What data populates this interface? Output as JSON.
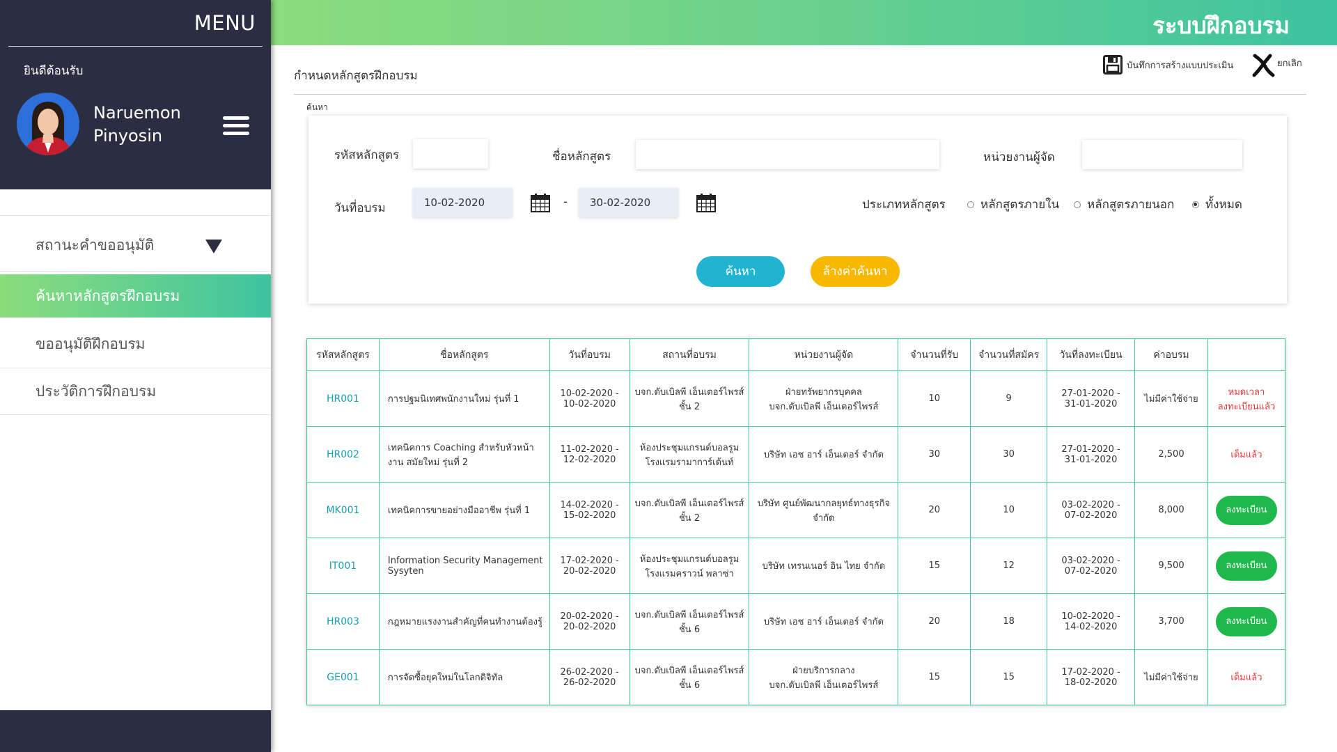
{
  "sidebar": {
    "menu_title": "MENU",
    "welcome": "ยินดีต้อนรับ",
    "user": {
      "first_name": "Naruemon",
      "last_name": "Pinyosin"
    },
    "items": [
      {
        "label": "สถานะคำขออนุมัติ"
      },
      {
        "label": "ค้นหาหลักสูตรฝึกอบรม"
      },
      {
        "label": "ขออนุมัติฝึกอบรม"
      },
      {
        "label": "ประวัติการฝึกอบรม"
      }
    ]
  },
  "header": {
    "system_title": "ระบบฝึกอบรม"
  },
  "page": {
    "title": "กำหนดหลักสูตรฝึกอบรม",
    "save_label": "บันทึกการสร้างแบบประเมิน",
    "cancel_label": "ยกเลิก",
    "search_caption": "ค้นหา"
  },
  "search": {
    "course_code_label": "รหัสหลักสูตร",
    "course_code_value": "",
    "course_name_label": "ชื่อหลักสูตร",
    "course_name_value": "",
    "organizer_label": "หน่วยงานผู้จัด",
    "organizer_value": "",
    "date_label": "วันที่อบรม",
    "date_from": "10-02-2020",
    "date_separator": "-",
    "date_to": "30-02-2020",
    "type_label": "ประเภทหลักสูตร",
    "type_options": [
      {
        "label": "หลักสูตรภายใน",
        "selected": false
      },
      {
        "label": "หลักสูตรภายนอก",
        "selected": false
      },
      {
        "label": "ทั้งหมด",
        "selected": true
      }
    ],
    "search_button": "ค้นหา",
    "clear_button": "ล้างค่าค้นหา"
  },
  "table": {
    "headers": [
      "รหัสหลักสูตร",
      "ชื่อหลักสูตร",
      "วันที่อบรม",
      "สถานที่อบรม",
      "หน่วยงานผู้จัด",
      "จำนวนที่รับ",
      "จำนวนที่สมัคร",
      "วันที่ลงทะเบียน",
      "ค่าอบรม",
      ""
    ],
    "rows": [
      {
        "code": "HR001",
        "name": "การปฐมนิเทศพนักงานใหม่ รุ่นที่ 1",
        "train_date_1": "10-02-2020 -",
        "train_date_2": "10-02-2020",
        "place_1": "บจก.ดับเบิลพี เอ็นเตอร์ไพรส์",
        "place_2": "ชั้น 2",
        "org_1": "ฝ่ายทรัพยากรบุคคล",
        "org_2": "บจก.ดับเบิลพี เอ็นเตอร์ไพรส์",
        "capacity": "10",
        "applied": "9",
        "reg_date_1": "27-01-2020 -",
        "reg_date_2": "31-01-2020",
        "fee": "ไม่มีค่าใช้จ่าย",
        "status_1": "หมดเวลา",
        "status_2": "ลงทะเบียนแล้ว",
        "status_type": "text"
      },
      {
        "code": "HR002",
        "name": "เทคนิคการ Coaching สำหรับหัวหน้างาน สมัยใหม่ รุ่นที่ 2",
        "train_date_1": "11-02-2020 -",
        "train_date_2": "12-02-2020",
        "place_1": "ห้องประชุมแกรนด์บอลรูม",
        "place_2": "โรงแรมรามาการ์เด้นท์",
        "org_1": "บริษัท เอช อาร์ เอ็นเตอร์ จำกัด",
        "org_2": "",
        "capacity": "30",
        "applied": "30",
        "reg_date_1": "27-01-2020 -",
        "reg_date_2": "31-01-2020",
        "fee": "2,500",
        "status_1": "เต็มแล้ว",
        "status_2": "",
        "status_type": "text"
      },
      {
        "code": "MK001",
        "name": "เทคนิคการขายอย่างมืออาชีพ รุ่นที่ 1",
        "train_date_1": "14-02-2020 -",
        "train_date_2": "15-02-2020",
        "place_1": "บจก.ดับเบิลพี เอ็นเตอร์ไพรส์",
        "place_2": "ชั้น 2",
        "org_1": "บริษัท ศูนย์พัฒนากลยุทธ์ทางธุรกิจ",
        "org_2": "จำกัด",
        "capacity": "20",
        "applied": "10",
        "reg_date_1": "03-02-2020 -",
        "reg_date_2": "07-02-2020",
        "fee": "8,000",
        "status_1": "ลงทะเบียน",
        "status_2": "",
        "status_type": "button"
      },
      {
        "code": "IT001",
        "name": "Information Security Management Sysyten",
        "train_date_1": "17-02-2020 -",
        "train_date_2": "20-02-2020",
        "place_1": "ห้องประชุมแกรนด์บอลรูม",
        "place_2": "โรงแรมคราวน์ พลาซ่า",
        "org_1": "บริษัท เทรนเนอร์ อิน ไทย จำกัด",
        "org_2": "",
        "capacity": "15",
        "applied": "12",
        "reg_date_1": "03-02-2020 -",
        "reg_date_2": "07-02-2020",
        "fee": "9,500",
        "status_1": "ลงทะเบียน",
        "status_2": "",
        "status_type": "button"
      },
      {
        "code": "HR003",
        "name": "กฎหมายแรงงานสำคัญที่คนทำงานต้องรู้",
        "train_date_1": "20-02-2020 -",
        "train_date_2": "20-02-2020",
        "place_1": "บจก.ดับเบิลพี เอ็นเตอร์ไพรส์",
        "place_2": "ชั้น 6",
        "org_1": "บริษัท เอช อาร์ เอ็นเตอร์ จำกัด",
        "org_2": "",
        "capacity": "20",
        "applied": "18",
        "reg_date_1": "10-02-2020 -",
        "reg_date_2": "14-02-2020",
        "fee": "3,700",
        "status_1": "ลงทะเบียน",
        "status_2": "",
        "status_type": "button"
      },
      {
        "code": "GE001",
        "name": "การจัดซื้อยุคใหม่ในโลกดิจิทัล",
        "train_date_1": "26-02-2020 -",
        "train_date_2": "26-02-2020",
        "place_1": "บจก.ดับเบิลพี เอ็นเตอร์ไพรส์",
        "place_2": "ชั้น 6",
        "org_1": "ฝ่ายบริการกลาง",
        "org_2": "บจก.ดับเบิลพี เอ็นเตอร์ไพรส์",
        "capacity": "15",
        "applied": "15",
        "reg_date_1": "17-02-2020 -",
        "reg_date_2": "18-02-2020",
        "fee": "ไม่มีค่าใช้จ่าย",
        "status_1": "เต็มแล้ว",
        "status_2": "",
        "status_type": "text"
      }
    ]
  },
  "colors": {
    "sidebar_dark": "#2b2d42",
    "gradient_start": "#8cdd7d",
    "gradient_end": "#3ec4a0",
    "search_button": "#21b4d0",
    "clear_button": "#f9b800",
    "register_button": "#1fb84c",
    "status_red": "#e53935",
    "code_link": "#1a9bb5"
  }
}
